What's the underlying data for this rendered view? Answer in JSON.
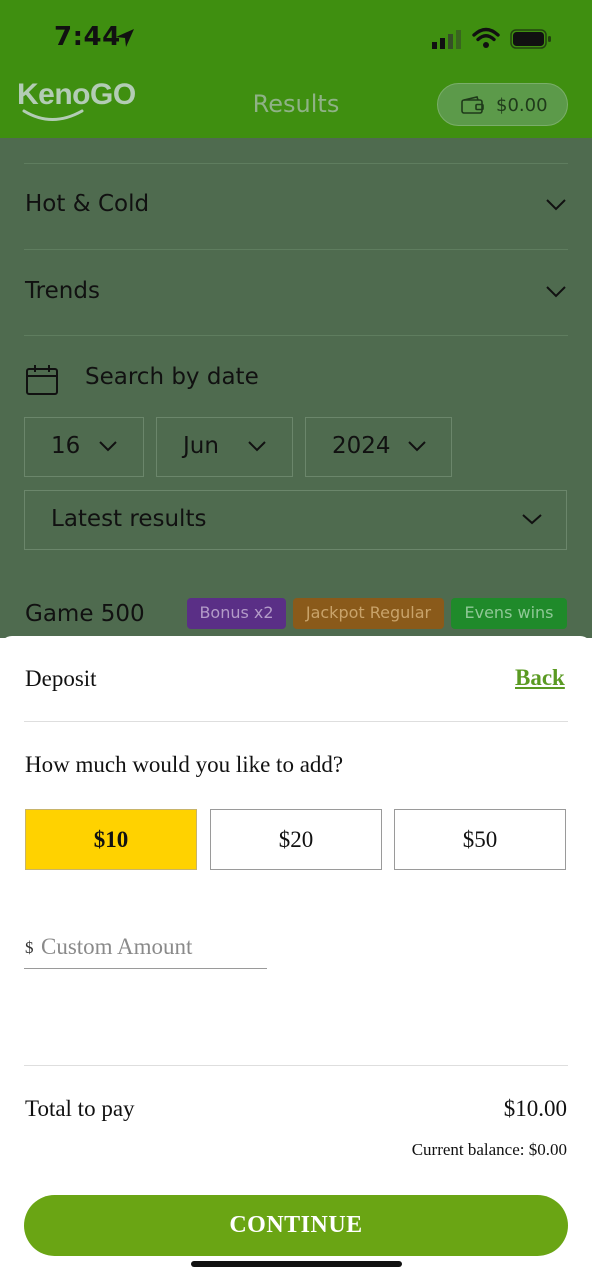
{
  "status_bar": {
    "time": "7:44"
  },
  "header": {
    "logo": "KenoGO",
    "title": "Results",
    "wallet_amount": "$0.00"
  },
  "background": {
    "accordions": [
      {
        "label": "Hot & Cold",
        "icon": "chevron-down-icon"
      },
      {
        "label": "Trends",
        "icon": "chevron-down-icon"
      }
    ],
    "search_label": "Search by date",
    "date": {
      "day": "16",
      "month": "Jun",
      "year": "2024"
    },
    "results_select": "Latest results",
    "game": {
      "label": "Game 500",
      "badges": [
        {
          "label": "Bonus x2",
          "color": "#5a2f86"
        },
        {
          "label": "Jackpot Regular",
          "color": "#8a5a1a"
        },
        {
          "label": "Evens wins",
          "color": "#1f8a2a"
        }
      ]
    }
  },
  "sheet": {
    "title": "Deposit",
    "back_label": "Back",
    "question": "How much would you like to add?",
    "amounts": [
      {
        "label": "$10",
        "selected": true
      },
      {
        "label": "$20",
        "selected": false
      },
      {
        "label": "$50",
        "selected": false
      }
    ],
    "custom_prefix": "$",
    "custom_placeholder": "Custom Amount",
    "total_label": "Total to pay",
    "total_value": "$10.00",
    "balance": "Current balance: $0.00",
    "continue_label": "CONTINUE"
  },
  "colors": {
    "header": "#3f8f10",
    "selected_amount": "#ffd200",
    "accent": "#6aa514",
    "overlay": "#4f6b4f"
  }
}
